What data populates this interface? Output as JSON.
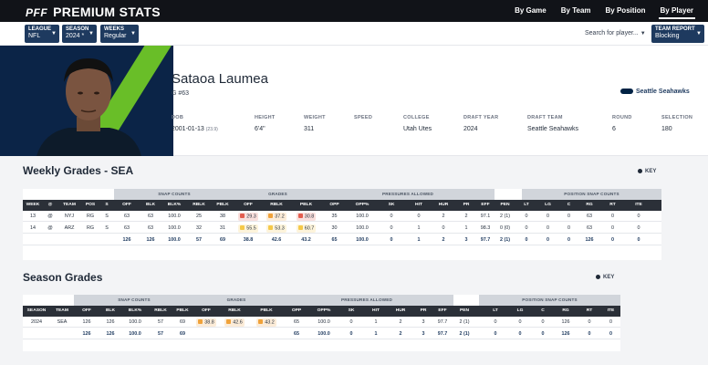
{
  "header": {
    "pff": "PFF",
    "title": "PREMIUM STATS",
    "nav": [
      "By Game",
      "By Team",
      "By Position",
      "By Player"
    ]
  },
  "filters": [
    {
      "label": "LEAGUE",
      "value": "NFL"
    },
    {
      "label": "SEASON",
      "value": "2024 *"
    },
    {
      "label": "WEEKS",
      "value": "Regular"
    },
    {
      "label": "TEAM REPORT",
      "value": "Blocking"
    }
  ],
  "search": {
    "placeholder": "Search for player..."
  },
  "player": {
    "name": "Sataoa Laumea",
    "position": "G #63",
    "team": "Seattle Seahawks",
    "bio": [
      {
        "label": "DOB",
        "value": "2001-01-13",
        "note": "(23.9)"
      },
      {
        "label": "HEIGHT",
        "value": "6'4\""
      },
      {
        "label": "WEIGHT",
        "value": "311"
      },
      {
        "label": "SPEED",
        "value": ""
      },
      {
        "label": "COLLEGE",
        "value": "Utah Utes"
      },
      {
        "label": "DRAFT YEAR",
        "value": "2024"
      },
      {
        "label": "DRAFT TEAM",
        "value": "Seattle Seahawks"
      },
      {
        "label": "ROUND",
        "value": "6"
      },
      {
        "label": "SELECTION",
        "value": "180"
      }
    ]
  },
  "key_label": "KEY",
  "colors": {
    "red": "#e35d4f",
    "orange": "#f0a23a",
    "yellow": "#f5c94a",
    "navy": "#1e3a5f",
    "seahawks_green": "#69be28"
  },
  "weekly": {
    "title": "Weekly Grades - SEA",
    "groups": [
      "SNAP COUNTS",
      "GRADES",
      "PRESSURES ALLOWED",
      "POSITION SNAP COUNTS"
    ],
    "columns": [
      "WEEK",
      "@",
      "TEAM",
      "POS",
      "S",
      "OFF",
      "BLK",
      "BLK%",
      "RBLK",
      "PBLK",
      "OFF",
      "RBLK",
      "PBLK",
      "OPP",
      "OPP%",
      "SK",
      "HIT",
      "HUR",
      "PR",
      "EFF",
      "PEN",
      "LT",
      "LG",
      "C",
      "RG",
      "RT",
      "ITE"
    ],
    "rows": [
      [
        "13",
        "@",
        "NYJ",
        "RG",
        "S",
        "63",
        "63",
        "100.0",
        "25",
        "38",
        "29.3",
        "37.2",
        "30.8",
        "35",
        "100.0",
        "0",
        "0",
        "2",
        "2",
        "97.1",
        "2 (1)",
        "0",
        "0",
        "0",
        "63",
        "0",
        "0"
      ],
      [
        "14",
        "@",
        "ARZ",
        "RG",
        "S",
        "63",
        "63",
        "100.0",
        "32",
        "31",
        "55.5",
        "53.3",
        "60.7",
        "30",
        "100.0",
        "0",
        "1",
        "0",
        "1",
        "98.3",
        "0 (0)",
        "0",
        "0",
        "0",
        "63",
        "0",
        "0"
      ]
    ],
    "totals": [
      "",
      "",
      "",
      "",
      "",
      "126",
      "126",
      "100.0",
      "57",
      "69",
      "38.8",
      "42.6",
      "43.2",
      "65",
      "100.0",
      "0",
      "1",
      "2",
      "3",
      "97.7",
      "2 (1)",
      "0",
      "0",
      "0",
      "126",
      "0",
      "0"
    ],
    "grade_colors": [
      [
        "red",
        "orange",
        "red"
      ],
      [
        "yellow",
        "yellow",
        "yellow"
      ]
    ]
  },
  "season": {
    "title": "Season Grades",
    "groups": [
      "SNAP COUNTS",
      "GRADES",
      "PRESSURES ALLOWED",
      "POSITION SNAP COUNTS"
    ],
    "columns": [
      "SEASON",
      "TEAM",
      "OFF",
      "BLK",
      "BLK%",
      "RBLK",
      "PBLK",
      "OFF",
      "RBLK",
      "PBLK",
      "OPP",
      "OPP%",
      "SK",
      "HIT",
      "HUR",
      "PR",
      "EFF",
      "PEN",
      "LT",
      "LG",
      "C",
      "RG",
      "RT",
      "ITE"
    ],
    "rows": [
      [
        "2024",
        "SEA",
        "126",
        "126",
        "100.0",
        "57",
        "69",
        "38.8",
        "42.6",
        "43.2",
        "65",
        "100.0",
        "0",
        "1",
        "2",
        "3",
        "97.7",
        "2 (1)",
        "0",
        "0",
        "0",
        "126",
        "0",
        "0"
      ]
    ],
    "totals": [
      "",
      "",
      "126",
      "126",
      "100.0",
      "57",
      "69",
      "",
      "",
      "",
      "65",
      "100.0",
      "0",
      "1",
      "2",
      "3",
      "97.7",
      "2 (1)",
      "0",
      "0",
      "0",
      "126",
      "0",
      "0"
    ],
    "grade_colors": [
      [
        "orange",
        "orange",
        "orange"
      ]
    ]
  }
}
